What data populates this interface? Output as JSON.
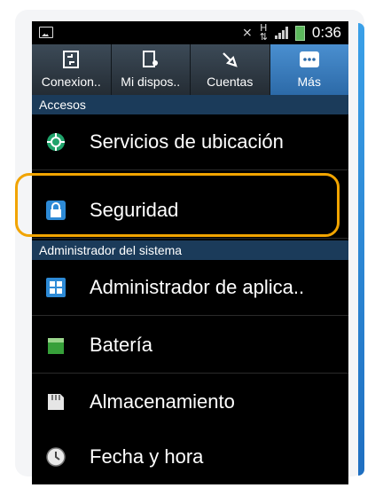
{
  "status_bar": {
    "time": "0:36"
  },
  "tabs": [
    {
      "label": "Conexion..",
      "icon": "connections-icon",
      "active": false
    },
    {
      "label": "Mi dispos..",
      "icon": "my-device-icon",
      "active": false
    },
    {
      "label": "Cuentas",
      "icon": "accounts-icon",
      "active": false
    },
    {
      "label": "Más",
      "icon": "more-icon",
      "active": true
    }
  ],
  "sections": {
    "accesos": "Accesos",
    "admin": "Administrador del sistema"
  },
  "items": {
    "ubicacion": "Servicios de ubicación",
    "seguridad": "Seguridad",
    "aplicaciones": "Administrador de aplica..",
    "bateria": "Batería",
    "almacenamiento": "Almacenamiento",
    "fecha": "Fecha y hora"
  },
  "highlight_color": "#f1a400"
}
